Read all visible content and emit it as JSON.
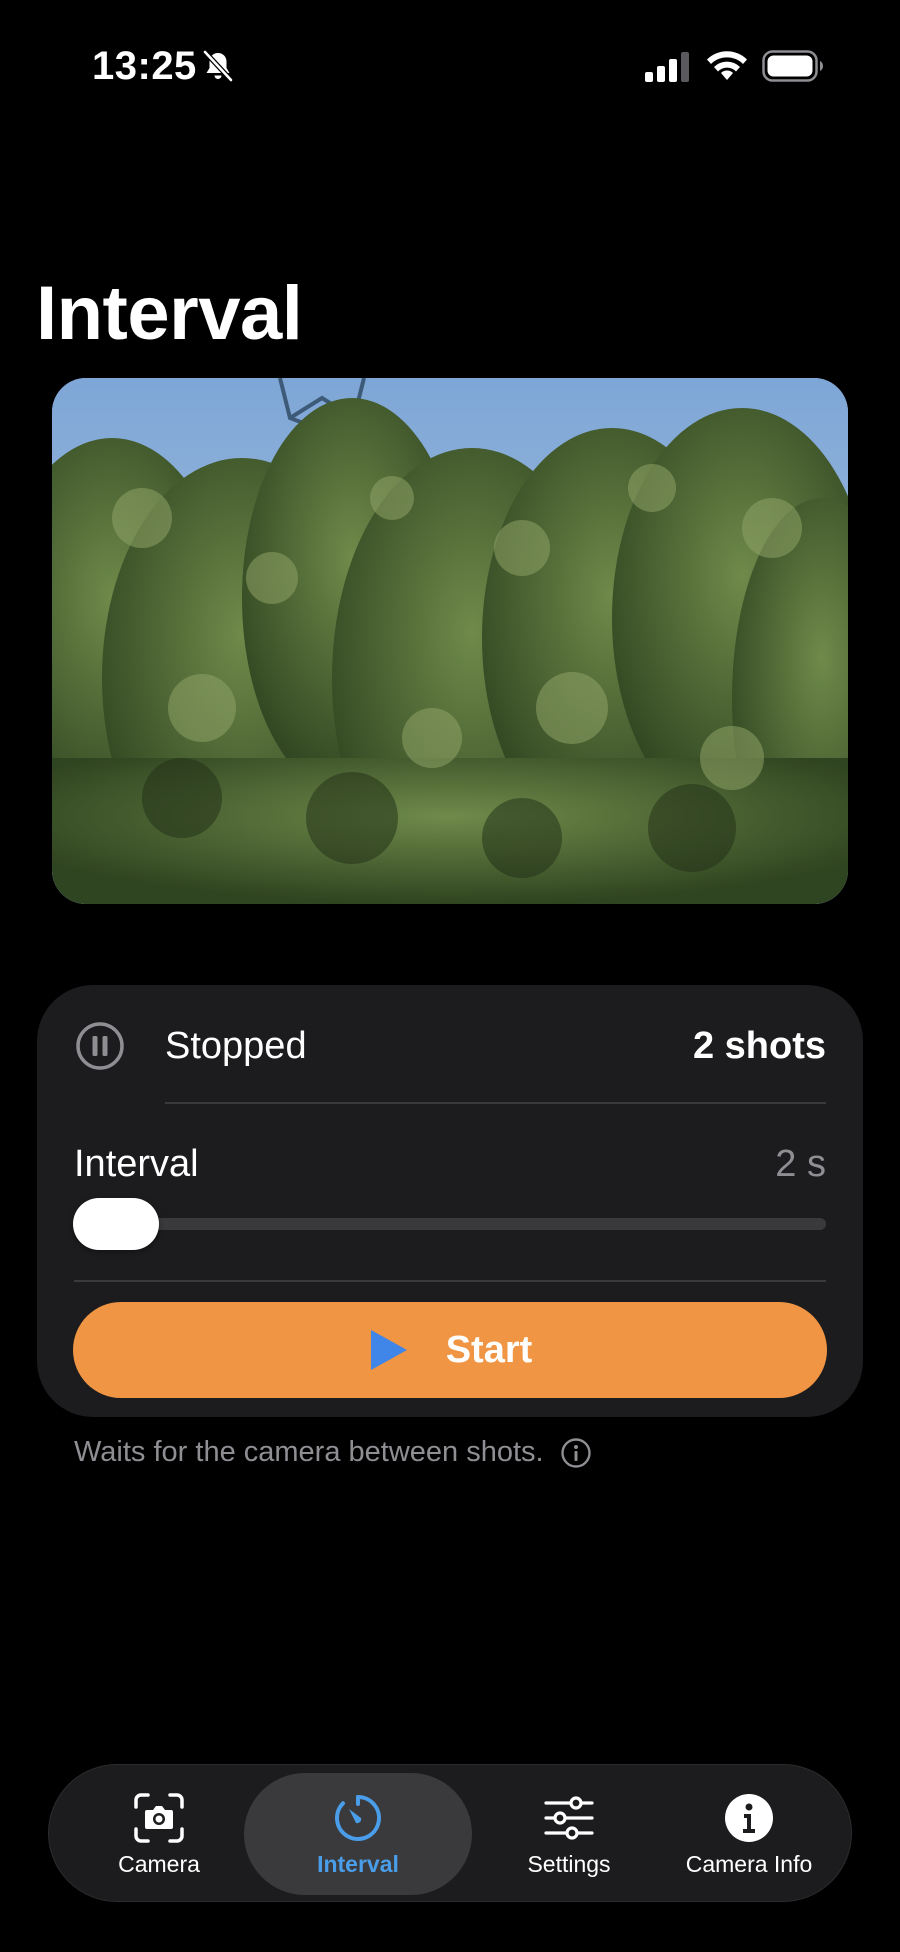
{
  "status_bar": {
    "time": "13:25",
    "icons": [
      "bell-slash-icon",
      "cellular-signal-icon",
      "wifi-icon",
      "battery-icon"
    ]
  },
  "page": {
    "title": "Interval"
  },
  "preview": {
    "description_icon": "camera-live-preview"
  },
  "card": {
    "status_icon": "pause-circle-icon",
    "status": "Stopped",
    "shots": "2 shots",
    "interval_label": "Interval",
    "interval_value": "2 s",
    "slider_level": 0.0,
    "start_label": "Start",
    "start_icon": "play-icon"
  },
  "footnote": {
    "text": "Waits for the camera between shots.",
    "icon": "info-circle-icon"
  },
  "tabbar": {
    "tabs": [
      {
        "label": "Camera",
        "icon": "camera-viewfinder-icon",
        "active": false
      },
      {
        "label": "Interval",
        "icon": "timer-icon",
        "active": true
      },
      {
        "label": "Settings",
        "icon": "sliders-icon",
        "active": false
      },
      {
        "label": "Camera Info",
        "icon": "info-circle-icon",
        "active": false
      }
    ]
  },
  "colors": {
    "background": "#000000",
    "card": "#1c1c1e",
    "accent_orange": "#f09543",
    "accent_blue": "#4a9de8",
    "secondary_text": "#8e8e93"
  }
}
